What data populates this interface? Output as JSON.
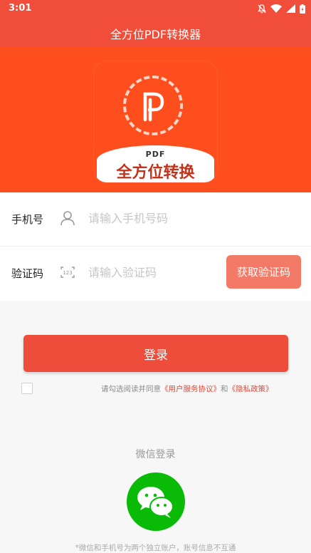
{
  "status_bar": {
    "time": "3:01",
    "icons": [
      "bell-off-icon",
      "wifi-icon",
      "signal-icon",
      "battery-icon"
    ]
  },
  "app": {
    "title": "全方位PDF转换器"
  },
  "logo": {
    "badge_text": "PDF",
    "name": "全方位转换"
  },
  "form": {
    "phone_label": "手机号",
    "phone_placeholder": "请输入手机号码",
    "phone_value": "",
    "code_label": "验证码",
    "code_placeholder": "请输入验证码",
    "code_value": "",
    "get_code_button": "获取验证码"
  },
  "login_button": "登录",
  "agreement": {
    "checked": false,
    "prefix": "请勾选阅读并同意",
    "link1": "《用户服务协议》",
    "and": "和",
    "link2": "《隐私政策》"
  },
  "wechat": {
    "title": "微信登录",
    "note": "*微信和手机号为两个独立账户，账号信息不互通"
  },
  "colors": {
    "accent": "#f04e3a",
    "hero_bg": "#ff4e1d",
    "wechat_green": "#09bb07",
    "code_button": "#f47a68"
  }
}
